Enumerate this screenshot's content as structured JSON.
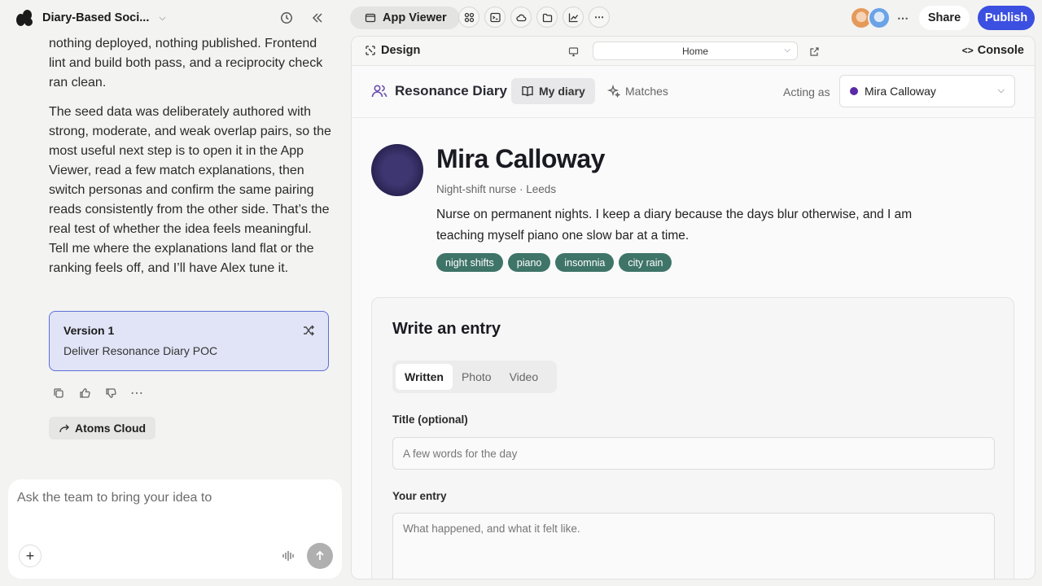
{
  "project": {
    "title": "Diary-Based Soci..."
  },
  "chat": {
    "paragraphs": [
      "nothing deployed, nothing published. Frontend lint and build both pass, and a reciprocity check ran clean.",
      "The seed data was deliberately authored with strong, moderate, and weak overlap pairs, so the most useful next step is to open it in the App Viewer, read a few match explanations, then switch personas and confirm the same pairing reads consistently from the other side. That’s the real test of whether the idea feels meaningful. Tell me where the explanations land flat or the ranking feels off, and I’ll have Alex tune it."
    ],
    "version_card": {
      "title": "Version 1",
      "subtitle": "Deliver Resonance Diary POC"
    },
    "cloud_button": "Atoms Cloud",
    "composer_placeholder": "Ask the team to bring your idea to"
  },
  "topbar": {
    "app_viewer_tab": "App Viewer",
    "share_label": "Share",
    "publish_label": "Publish"
  },
  "preview": {
    "design_label": "Design",
    "url": "Home",
    "console_label": "Console"
  },
  "app": {
    "brand": "Resonance Diary",
    "nav": {
      "my_diary": "My diary",
      "matches": "Matches"
    },
    "acting_as_label": "Acting as",
    "persona": "Mira Calloway",
    "profile": {
      "name": "Mira Calloway",
      "meta": "Night-shift nurse · Leeds",
      "bio": "Nurse on permanent nights. I keep a diary because the days blur otherwise, and I am teaching myself piano one slow bar at a time.",
      "tags": [
        "night shifts",
        "piano",
        "insomnia",
        "city rain"
      ]
    },
    "entry": {
      "heading": "Write an entry",
      "modes": [
        "Written",
        "Photo",
        "Video"
      ],
      "title_label": "Title (optional)",
      "title_placeholder": "A few words for the day",
      "body_label": "Your entry",
      "body_placeholder": "What happened, and what it felt like."
    }
  },
  "colors": {
    "publish": "#3b4fe0",
    "version_card_bg": "#e1e4f6",
    "version_card_border": "#5b6fd8",
    "tag_bg": "#3f7468",
    "persona_dot": "#5b2aa6"
  }
}
